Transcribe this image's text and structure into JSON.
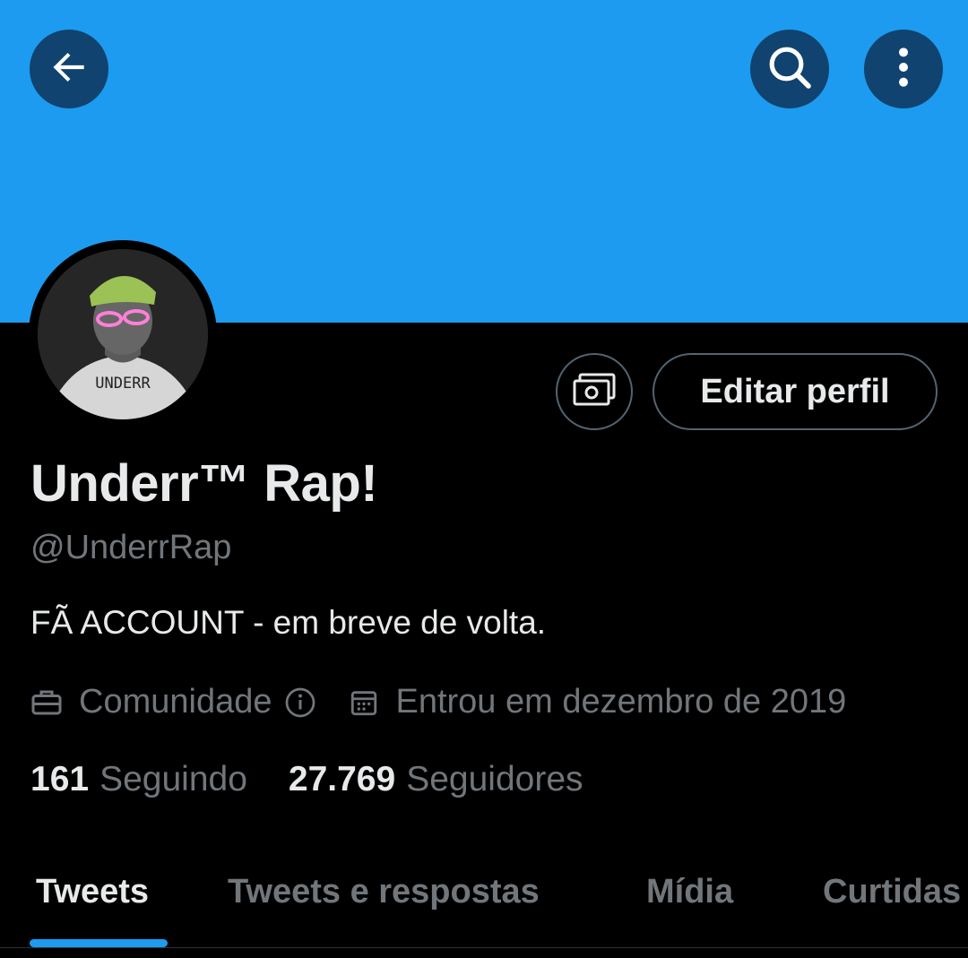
{
  "header": {
    "back_icon": "arrow-left-icon",
    "search_icon": "search-icon",
    "more_icon": "more-vertical-icon",
    "banner_color": "#1d9bf0"
  },
  "profile": {
    "display_name": "Underr™ Rap!",
    "handle": "@UnderrRap",
    "bio": "FÃ ACCOUNT - em breve de volta.",
    "category": "Comunidade",
    "joined": "Entrou em dezembro de 2019",
    "avatar_text": "UNDERR"
  },
  "actions": {
    "subscribe_icon": "money-icon",
    "edit_label": "Editar perfil"
  },
  "stats": {
    "following_count": "161",
    "following_label": "Seguindo",
    "followers_count": "27.769",
    "followers_label": "Seguidores"
  },
  "tabs": [
    {
      "label": "Tweets",
      "active": true
    },
    {
      "label": "Tweets e respostas",
      "active": false
    },
    {
      "label": "Mídia",
      "active": false
    },
    {
      "label": "Curtidas",
      "active": false
    }
  ]
}
